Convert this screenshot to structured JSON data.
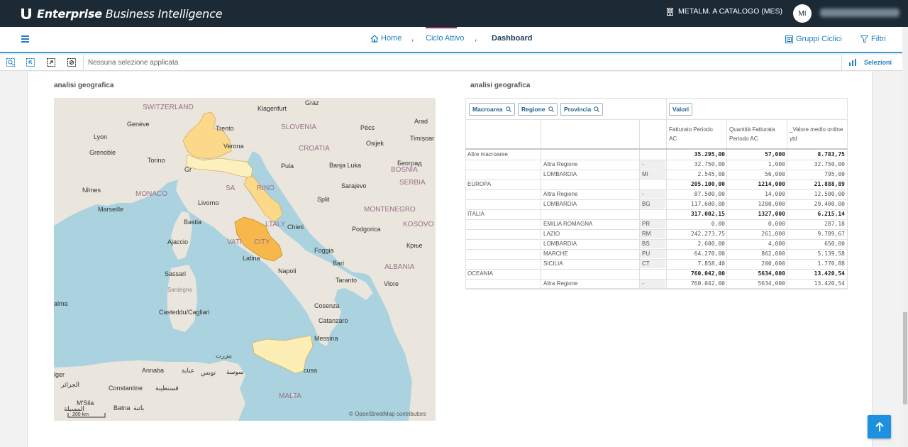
{
  "app": {
    "brand_bold": "Enterprise",
    "brand_rest": " Business Intelligence"
  },
  "header": {
    "company": "METALM. A CATALOGO (MES)",
    "avatar_initials": "MI"
  },
  "breadcrumb": {
    "home": "Home",
    "sep1": ",",
    "ciclo": "Ciclo Attivo",
    "sep2": ",",
    "current": "Dashboard"
  },
  "nav": {
    "gruppi": "Gruppi Ciclici",
    "filtri": "Filtri"
  },
  "selection": {
    "text": "Nessuna selezione applicata",
    "selezioni": "Selezioni"
  },
  "panels": {
    "map_title": "analisi geografica",
    "table_title": "analisi geografica"
  },
  "map": {
    "attribution": "© OpenStreetMap contributors",
    "scale": "200 km",
    "labels": {
      "switzerland": "SWITZERLAND",
      "slovenia": "SLOVENIA",
      "croatia": "CROATIA",
      "bosnia": "BOSNIA",
      "serbia": "SERBIA",
      "montenegro": "MONTENEGRO",
      "kosovo": "KOSOVO",
      "albania": "ALBANIA",
      "monaco": "MONACO",
      "italy": "ITALY",
      "vatican": "VATICAN CITY",
      "sanmarino": "SAN MARINO",
      "malta": "MALTA",
      "klagenfurt": "Klagenfurt",
      "graz": "Graz",
      "arad": "Arad",
      "pecs": "Pécs",
      "timisoara": "Timișoar",
      "osijek": "Osijek",
      "geneve": "Genève",
      "lyon": "Lyon",
      "grenoble": "Grenoble",
      "trento": "Trento",
      "verona": "Verona",
      "torino": "Torino",
      "nimes": "Nîmes",
      "marseille": "Marseille",
      "livorno": "Livorno",
      "pula": "Pula",
      "banjaluka": "Banja Luka",
      "beograd": "Београд",
      "sarajevo": "Sarajevo",
      "split": "Split",
      "chieti": "Chieti",
      "podgorica": "Podgorica",
      "bastia": "Bastia",
      "ajaccio": "Ajaccio",
      "latina": "Latina",
      "foggia": "Foggia",
      "krnje": "Крње",
      "napoli": "Napoli",
      "bari": "Bari",
      "sassari": "Sassari",
      "sardegna": "Sardegna",
      "taranto": "Taranto",
      "vlore": "Vlore",
      "cagliari": "Casteddu/Cagliari",
      "cosenza": "Cosenza",
      "catanzaro": "Catanzaro",
      "messina": "Messina",
      "annaba": "Annaba",
      "annaba_ar": "عنابة",
      "tunis_ar": "تونس",
      "bizerte_ar": "بنزرت",
      "constantine": "Constantine",
      "constantine_ar": "قسنطينة",
      "siracusa": "cusa",
      "palma": "alma",
      "alger": "lger",
      "alger_ar": "الجزائر",
      "msila": "M'Sila",
      "msila_ar": "المسيلة",
      "batna": "Batna",
      "batna_ar": "باتنة",
      "sousse_ar": "سوسة",
      "gr": "Gr",
      "sa": "SA",
      "rino": "RINO",
      "ltaly": "LTALY",
      "vati": "VATI",
      "city": "CITY"
    }
  },
  "table": {
    "dims": [
      "Macroarea",
      "Regione",
      "Provincia"
    ],
    "valori": "Valori",
    "columns": [
      "Fatturato Periodo AC",
      "Quantità Fatturata Periodo AC",
      "_Valore medio ordine ytd"
    ],
    "col_lines": [
      [
        "Fatturato Periodo",
        "AC"
      ],
      [
        "Quantità Fatturata",
        "Periodo AC"
      ],
      [
        "_Valore medio ordine",
        "ytd"
      ]
    ],
    "groups": [
      {
        "name": "Altre macroaree",
        "total": [
          "35.295,00",
          "57,000",
          "8.783,75"
        ],
        "rows": [
          {
            "regione": "Altra Regione",
            "prov": "-",
            "vals": [
              "32.750,00",
              "1,000",
              "32.750,00"
            ]
          },
          {
            "regione": "LOMBARDIA",
            "prov": "MI",
            "vals": [
              "2.545,00",
              "56,000",
              "795,00"
            ]
          }
        ]
      },
      {
        "name": "EUROPA",
        "total": [
          "205.100,00",
          "1214,000",
          "21.888,89"
        ],
        "rows": [
          {
            "regione": "Altra Regione",
            "prov": "-",
            "vals": [
              "87.500,00",
              "14,000",
              "12.500,00"
            ]
          },
          {
            "regione": "LOMBARDIA",
            "prov": "BG",
            "vals": [
              "117.600,00",
              "1200,000",
              "29.400,00"
            ]
          }
        ]
      },
      {
        "name": "ITALIA",
        "total": [
          "317.002,15",
          "1327,000",
          "6.215,14"
        ],
        "rows": [
          {
            "regione": "EMILIA ROMAGNA",
            "prov": "PR",
            "vals": [
              "0,00",
              "0,000",
              "287,18"
            ]
          },
          {
            "regione": "LAZIO",
            "prov": "RM",
            "vals": [
              "242.273,75",
              "261,000",
              "9.789,67"
            ]
          },
          {
            "regione": "LOMBARDIA",
            "prov": "BS",
            "vals": [
              "2.600,00",
              "4,000",
              "650,00"
            ]
          },
          {
            "regione": "MARCHE",
            "prov": "PU",
            "vals": [
              "64.270,00",
              "862,000",
              "5.139,58"
            ]
          },
          {
            "regione": "SICILIA",
            "prov": "CT",
            "vals": [
              "7.858,40",
              "200,000",
              "1.770,88"
            ]
          }
        ]
      },
      {
        "name": "OCEANIA",
        "total": [
          "760.042,00",
          "5634,000",
          "13.420,54"
        ],
        "rows": [
          {
            "regione": "Altra Regione",
            "prov": "-",
            "vals": [
              "760.042,00",
              "5634,000",
              "13.420,54"
            ]
          }
        ]
      }
    ]
  },
  "colors": {
    "topbar": "#1b2a35",
    "accent": "#1e7fc1",
    "region_high": "#f6b84b",
    "region_mid": "#fcd98a",
    "region_low": "#fdf0bf",
    "sea": "#aad3df",
    "land": "#eae6dd"
  }
}
